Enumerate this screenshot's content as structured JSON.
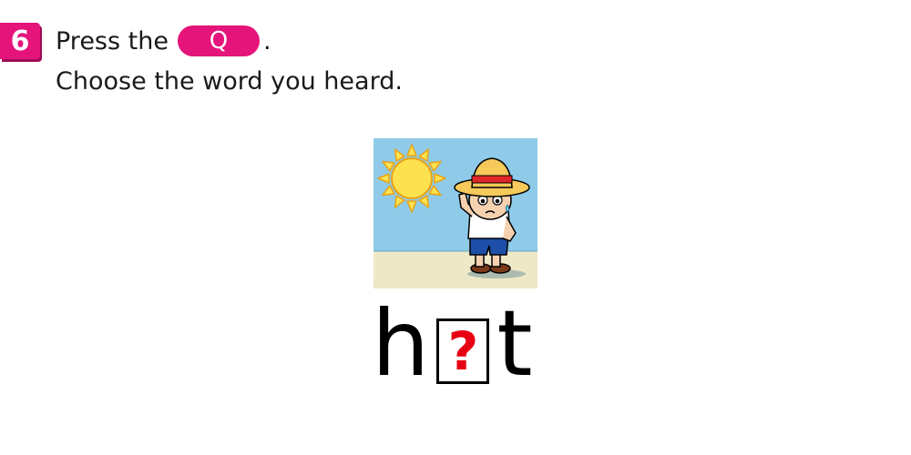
{
  "question": {
    "number": "6",
    "line1_prefix": "Press the",
    "button_label": "Q",
    "line1_suffix": ".",
    "line2": "Choose the word you heard."
  },
  "word": {
    "first": "h",
    "blank": "?",
    "last": "t"
  },
  "image": {
    "icon": "hot-day-boy-in-straw-hat-illustration",
    "sky_color": "#8fcbe8",
    "ground_color": "#eee8c6"
  },
  "colors": {
    "accent": "#e4147a",
    "question_mark": "#e60012"
  }
}
